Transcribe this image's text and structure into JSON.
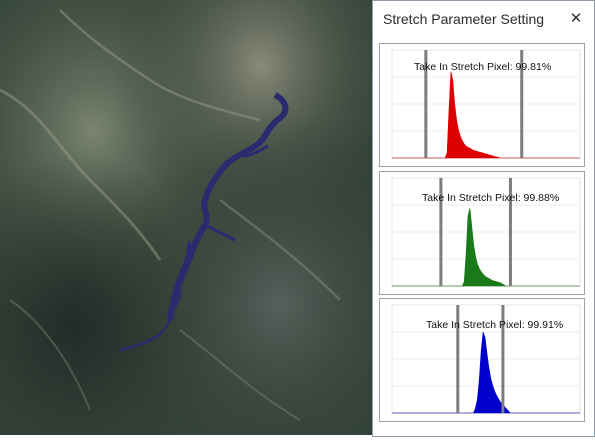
{
  "dialog": {
    "title": "Stretch Parameter Setting",
    "close_glyph": "✕"
  },
  "imagery": {
    "description_icon": "satellite-image"
  },
  "histograms": [
    {
      "band": "red",
      "color": "#dd0000",
      "label": "Take In Stretch Pixel: 99.81%",
      "stretch_min": 0.18,
      "stretch_max": 0.69,
      "shape": [
        0,
        0,
        0,
        0,
        0,
        0,
        0,
        0,
        0,
        0,
        0,
        0,
        0,
        0,
        0,
        0,
        0,
        0,
        0,
        0,
        0,
        0,
        0,
        0,
        0,
        0,
        0,
        0,
        0,
        0.05,
        0.45,
        0.8,
        0.72,
        0.5,
        0.35,
        0.26,
        0.2,
        0.16,
        0.13,
        0.11,
        0.1,
        0.09,
        0.08,
        0.07,
        0.065,
        0.06,
        0.055,
        0.05,
        0.045,
        0.04,
        0.035,
        0.03,
        0.025,
        0.02,
        0.015,
        0.01,
        0.006,
        0,
        0,
        0,
        0,
        0,
        0,
        0,
        0,
        0,
        0,
        0,
        0,
        0,
        0,
        0,
        0,
        0,
        0,
        0,
        0,
        0,
        0,
        0,
        0,
        0,
        0,
        0,
        0,
        0,
        0,
        0,
        0,
        0,
        0,
        0,
        0,
        0,
        0,
        0,
        0,
        0,
        0,
        0
      ]
    },
    {
      "band": "green",
      "color": "#1a7a1a",
      "label": "Take In Stretch Pixel: 99.88%",
      "stretch_min": 0.26,
      "stretch_max": 0.63,
      "shape": [
        0,
        0,
        0,
        0,
        0,
        0,
        0,
        0,
        0,
        0,
        0,
        0,
        0,
        0,
        0,
        0,
        0,
        0,
        0,
        0,
        0,
        0,
        0,
        0,
        0,
        0,
        0,
        0,
        0,
        0,
        0,
        0,
        0,
        0,
        0,
        0,
        0,
        0,
        0.04,
        0.3,
        0.65,
        0.72,
        0.55,
        0.38,
        0.27,
        0.2,
        0.16,
        0.13,
        0.11,
        0.09,
        0.08,
        0.07,
        0.06,
        0.05,
        0.045,
        0.04,
        0.035,
        0.03,
        0.02,
        0.01,
        0,
        0,
        0,
        0,
        0,
        0,
        0,
        0,
        0,
        0,
        0,
        0,
        0,
        0,
        0,
        0,
        0,
        0,
        0,
        0,
        0,
        0,
        0,
        0,
        0,
        0,
        0,
        0,
        0,
        0,
        0,
        0,
        0,
        0,
        0,
        0,
        0,
        0,
        0,
        0
      ]
    },
    {
      "band": "blue",
      "color": "#0000cc",
      "label": "Take In Stretch Pixel: 99.91%",
      "stretch_min": 0.35,
      "stretch_max": 0.59,
      "shape": [
        0,
        0,
        0,
        0,
        0,
        0,
        0,
        0,
        0,
        0,
        0,
        0,
        0,
        0,
        0,
        0,
        0,
        0,
        0,
        0,
        0,
        0,
        0,
        0,
        0,
        0,
        0,
        0,
        0,
        0,
        0,
        0,
        0,
        0,
        0,
        0,
        0,
        0,
        0,
        0,
        0,
        0,
        0,
        0.04,
        0.12,
        0.3,
        0.58,
        0.75,
        0.7,
        0.55,
        0.42,
        0.32,
        0.25,
        0.2,
        0.16,
        0.13,
        0.1,
        0.08,
        0.06,
        0.04,
        0.02,
        0,
        0,
        0,
        0,
        0,
        0,
        0,
        0,
        0,
        0,
        0,
        0,
        0,
        0,
        0,
        0,
        0,
        0,
        0,
        0,
        0,
        0,
        0,
        0,
        0,
        0,
        0,
        0,
        0,
        0,
        0,
        0,
        0,
        0,
        0,
        0,
        0
      ]
    }
  ]
}
